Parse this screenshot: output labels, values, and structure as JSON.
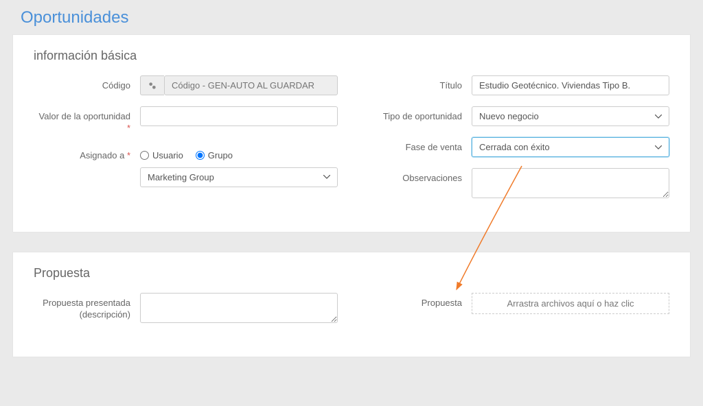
{
  "page": {
    "title": "Oportunidades"
  },
  "section_basic": {
    "title": "información básica",
    "codigo_label": "Código",
    "codigo_placeholder": "Código - GEN-AUTO AL GUARDAR",
    "valor_label": "Valor de la oportunidad",
    "asignado_label": "Asignado a",
    "radio_usuario": "Usuario",
    "radio_grupo": "Grupo",
    "grupo_value": "Marketing Group",
    "titulo_label": "Título",
    "titulo_value": "Estudio Geotécnico. Viviendas Tipo B.",
    "tipo_label": "Tipo de oportunidad",
    "tipo_value": "Nuevo negocio",
    "fase_label": "Fase de venta",
    "fase_value": "Cerrada con éxito",
    "obs_label": "Observaciones"
  },
  "section_propuesta": {
    "title": "Propuesta",
    "desc_label": "Propuesta presentada (descripción)",
    "file_label": "Propuesta",
    "dropzone_text": "Arrastra archivos aquí o haz clic"
  },
  "colors": {
    "accent": "#4a90d9",
    "arrow": "#f07b2a"
  }
}
